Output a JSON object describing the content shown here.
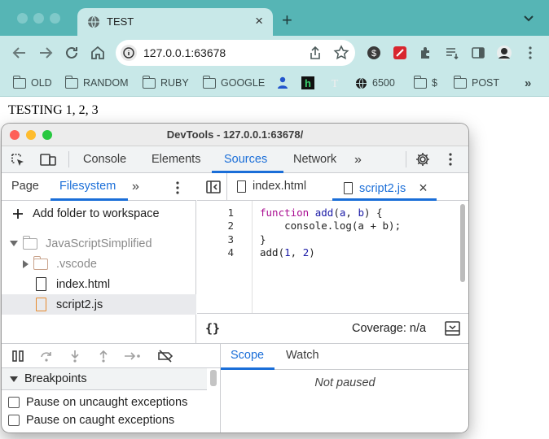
{
  "browser": {
    "tab": {
      "title": "TEST"
    },
    "url": "127.0.0.1:63678",
    "bookmarks": [
      {
        "label": "OLD",
        "icon": "folder-icon"
      },
      {
        "label": "RANDOM",
        "icon": "folder-icon"
      },
      {
        "label": "RUBY",
        "icon": "folder-icon"
      },
      {
        "label": "GOOGLE",
        "icon": "folder-icon"
      },
      {
        "label": "",
        "icon": "person-icon"
      },
      {
        "label": "",
        "icon": "h-site-icon"
      },
      {
        "label": "",
        "icon": "nyt-icon"
      },
      {
        "label": "6500",
        "icon": "globe-icon"
      },
      {
        "label": "$",
        "icon": "folder-icon"
      },
      {
        "label": "POST",
        "icon": "folder-icon"
      }
    ]
  },
  "page": {
    "text": "TESTING 1, 2, 3"
  },
  "devtools": {
    "window_title": "DevTools - 127.0.0.1:63678/",
    "main_tabs": [
      "Console",
      "Elements",
      "Sources",
      "Network"
    ],
    "active_main_tab": "Sources",
    "navigator_tabs": [
      "Page",
      "Filesystem"
    ],
    "active_navigator_tab": "Filesystem",
    "add_folder_label": "Add folder to workspace",
    "tree": [
      {
        "name": "JavaScriptSimplified",
        "type": "folder",
        "expanded": true
      },
      {
        "name": ".vscode",
        "type": "folder",
        "expanded": false
      },
      {
        "name": "index.html",
        "type": "file"
      },
      {
        "name": "script2.js",
        "type": "file",
        "selected": true
      }
    ],
    "editor_tabs": [
      "index.html",
      "script2.js"
    ],
    "active_editor_tab": "script2.js",
    "code_lines": [
      {
        "n": "1",
        "text": "function add(a, b) {"
      },
      {
        "n": "2",
        "text": "    console.log(a + b);"
      },
      {
        "n": "3",
        "text": "}"
      },
      {
        "n": "4",
        "text": "add(1, 2)"
      }
    ],
    "format_label": "{}",
    "coverage_label": "Coverage: n/a",
    "breakpoints_header": "Breakpoints",
    "breakpoint_options": [
      "Pause on uncaught exceptions",
      "Pause on caught exceptions"
    ],
    "scope_tabs": [
      "Scope",
      "Watch"
    ],
    "active_scope_tab": "Scope",
    "scope_status": "Not paused"
  },
  "colors": {
    "chrome_frame": "#56b5b5",
    "chrome_toolbar": "#c8e8e8",
    "accent_blue": "#1a6ed8",
    "file_orange": "#e68a2e"
  }
}
